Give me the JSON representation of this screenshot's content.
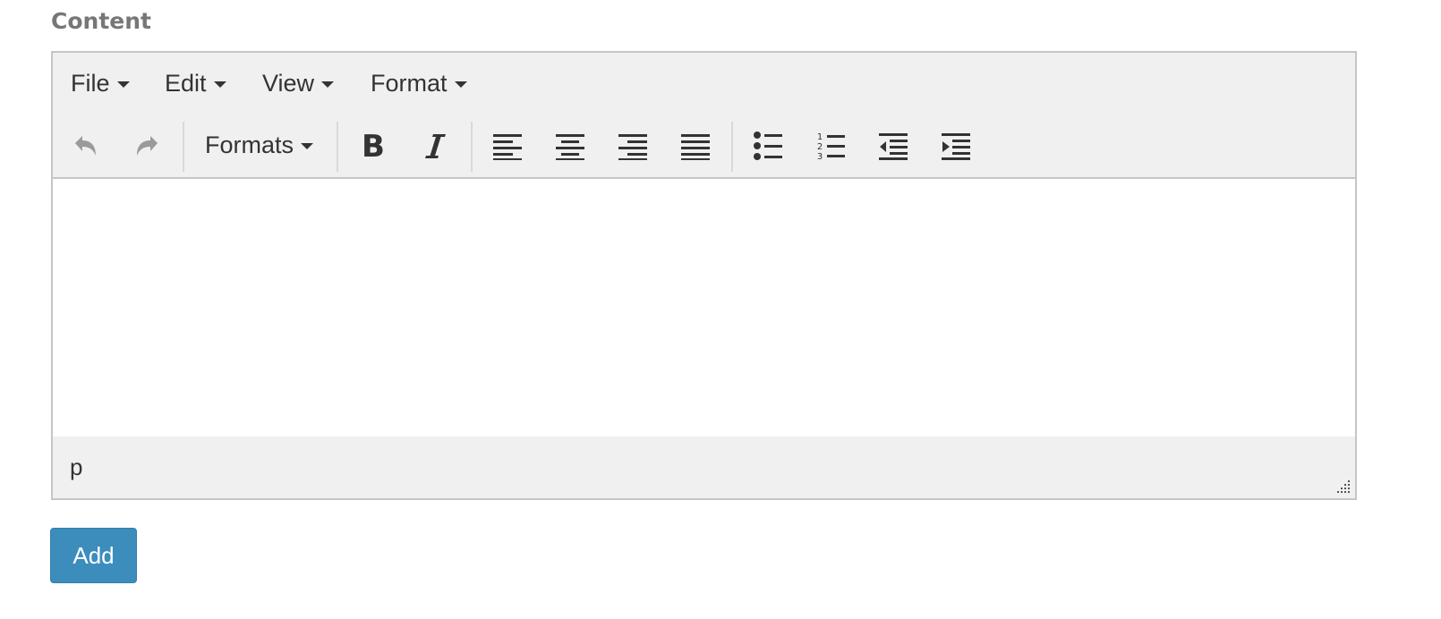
{
  "field": {
    "label": "Content"
  },
  "menubar": {
    "file": "File",
    "edit": "Edit",
    "view": "View",
    "format": "Format"
  },
  "toolbar": {
    "formats": "Formats",
    "buttons": [
      "undo-icon",
      "redo-icon",
      "bold-icon",
      "italic-icon",
      "align-left-icon",
      "align-center-icon",
      "align-right-icon",
      "align-justify-icon",
      "bullet-list-icon",
      "numbered-list-icon",
      "outdent-icon",
      "indent-icon"
    ]
  },
  "statusbar": {
    "path": "p"
  },
  "actions": {
    "add": "Add"
  },
  "colors": {
    "primary": "#3c8dbc",
    "toolbar_bg": "#f0f0f0",
    "border": "#c5c5c5",
    "label": "#777777"
  }
}
